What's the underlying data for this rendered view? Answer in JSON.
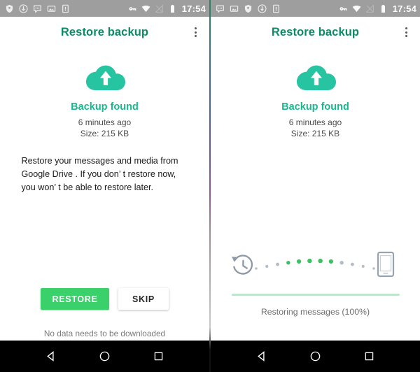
{
  "accent": {
    "title_teal": "#0d8a66",
    "heading_green": "#19b98c",
    "cloud_green": "#26c4a0",
    "button_green": "#3ad06a",
    "progress_track": "#e4f4ea",
    "progress_fill": "#bfe6cd",
    "dot_active": "#3ac162",
    "dot_inactive": "#b4bcc4",
    "statusbar_gray": "#9e9e9e",
    "navbar_black": "#000000"
  },
  "panels": [
    {
      "id": "left-panel",
      "statusbar": {
        "time": "17:54",
        "left_icons": [
          "shield-check-icon",
          "download-circle-icon",
          "messages-icon",
          "image-icon",
          "sim-card-icon"
        ],
        "right_icons": [
          "vpn-key-icon",
          "wifi-icon",
          "signal-off-icon",
          "battery-icon"
        ]
      },
      "appbar": {
        "title": "Restore backup",
        "overflow_label": "overflow-menu"
      },
      "hero": {
        "icon": "cloud-upload-icon",
        "heading": "Backup found",
        "time_ago": "6 minutes ago",
        "size": "Size: 215 KB"
      },
      "body_text": "Restore your messages and media from Google Drive . If you don’ t restore now, you won’ t be able to restore later.",
      "buttons": {
        "primary": "RESTORE",
        "secondary": "SKIP"
      },
      "footnote": "No data needs to be downloaded",
      "navbar": {
        "back": "back-icon",
        "home": "home-icon",
        "recents": "recents-icon"
      }
    },
    {
      "id": "right-panel",
      "statusbar": {
        "time": "17:54",
        "left_icons": [
          "messages-icon",
          "image-icon",
          "shield-check-icon",
          "download-circle-icon",
          "sim-card-icon"
        ],
        "right_icons": [
          "vpn-key-icon",
          "wifi-icon",
          "signal-off-icon",
          "battery-icon"
        ]
      },
      "appbar": {
        "title": "Restore backup",
        "overflow_label": "overflow-menu"
      },
      "hero": {
        "icon": "cloud-upload-icon",
        "heading": "Backup found",
        "time_ago": "6 minutes ago",
        "size": "Size: 215 KB"
      },
      "progress": {
        "source_icon": "history-restore-icon",
        "target_icon": "phone-icon",
        "percent": 100,
        "status": "Restoring messages (100%)",
        "dots": [
          {
            "active": false,
            "r": 1.7
          },
          {
            "active": false,
            "r": 2.1
          },
          {
            "active": false,
            "r": 2.4
          },
          {
            "active": true,
            "r": 2.7
          },
          {
            "active": true,
            "r": 3.1
          },
          {
            "active": true,
            "r": 3.2
          },
          {
            "active": true,
            "r": 3.2
          },
          {
            "active": true,
            "r": 3.1
          },
          {
            "active": false,
            "r": 2.7
          },
          {
            "active": false,
            "r": 2.4
          },
          {
            "active": false,
            "r": 2.0
          },
          {
            "active": false,
            "r": 1.7
          }
        ]
      },
      "navbar": {
        "back": "back-icon",
        "home": "home-icon",
        "recents": "recents-icon"
      }
    }
  ]
}
